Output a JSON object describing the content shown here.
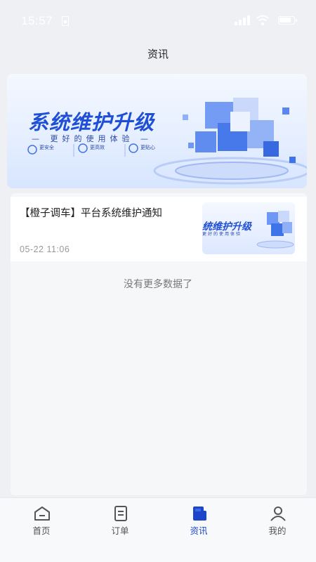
{
  "status_bar": {
    "time": "15:57"
  },
  "header": {
    "title": "资讯"
  },
  "banner": {
    "title": "系统维护升级",
    "subtitle": "— 更好的使用体验 —",
    "features": [
      "更安全",
      "更高效",
      "更贴心"
    ]
  },
  "news": [
    {
      "title": "【橙子调车】平台系统维护通知",
      "date": "05-22 11:06",
      "thumb_title": "统维护升级",
      "thumb_subtitle": "更好的使用体验"
    }
  ],
  "list_end_text": "没有更多数据了",
  "tabbar": {
    "items": [
      {
        "label": "首页",
        "icon": "home-icon"
      },
      {
        "label": "订单",
        "icon": "order-icon"
      },
      {
        "label": "资讯",
        "icon": "news-icon",
        "active": true
      },
      {
        "label": "我的",
        "icon": "user-icon"
      }
    ]
  },
  "colors": {
    "accent": "#1b46c9",
    "banner_blue": "#1f4fd6"
  }
}
